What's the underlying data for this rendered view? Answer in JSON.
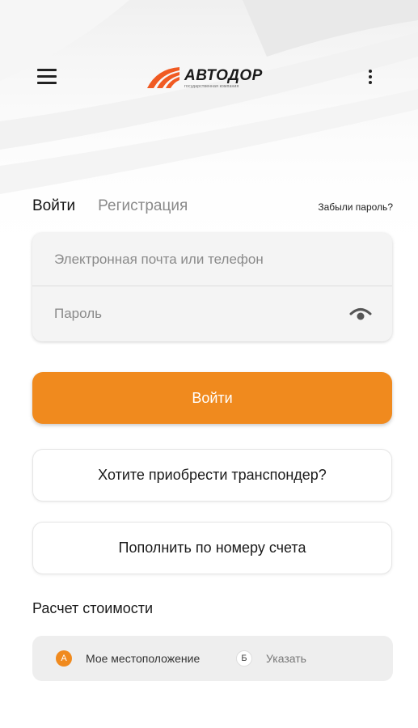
{
  "header": {
    "brand_name": "АВТОДОР",
    "brand_tagline": "государственная компания",
    "brand_color": "#f05a22",
    "menu_icon": "hamburger-icon",
    "more_icon": "kebab-menu-icon"
  },
  "auth": {
    "tabs": [
      {
        "label": "Войти",
        "active": true
      },
      {
        "label": "Регистрация",
        "active": false
      }
    ],
    "forgot_password": "Забыли пароль?",
    "email_placeholder": "Электронная почта или телефон",
    "email_value": "",
    "password_placeholder": "Пароль",
    "password_value": "",
    "password_toggle_icon": "eye-icon",
    "login_button": "Войти"
  },
  "actions": {
    "transponder": "Хотите приобрести транспондер?",
    "topup": "Пополнить по номеру счета"
  },
  "calculator": {
    "title": "Расчет стоимости",
    "point_a": {
      "badge": "А",
      "label": "Мое местоположение"
    },
    "point_b": {
      "badge": "Б",
      "label": "Указать"
    }
  },
  "colors": {
    "accent": "#f08a1e",
    "text": "#222222",
    "muted": "#8a8a8a",
    "field_bg": "#f4f4f4",
    "route_bg": "#eeeeee"
  }
}
